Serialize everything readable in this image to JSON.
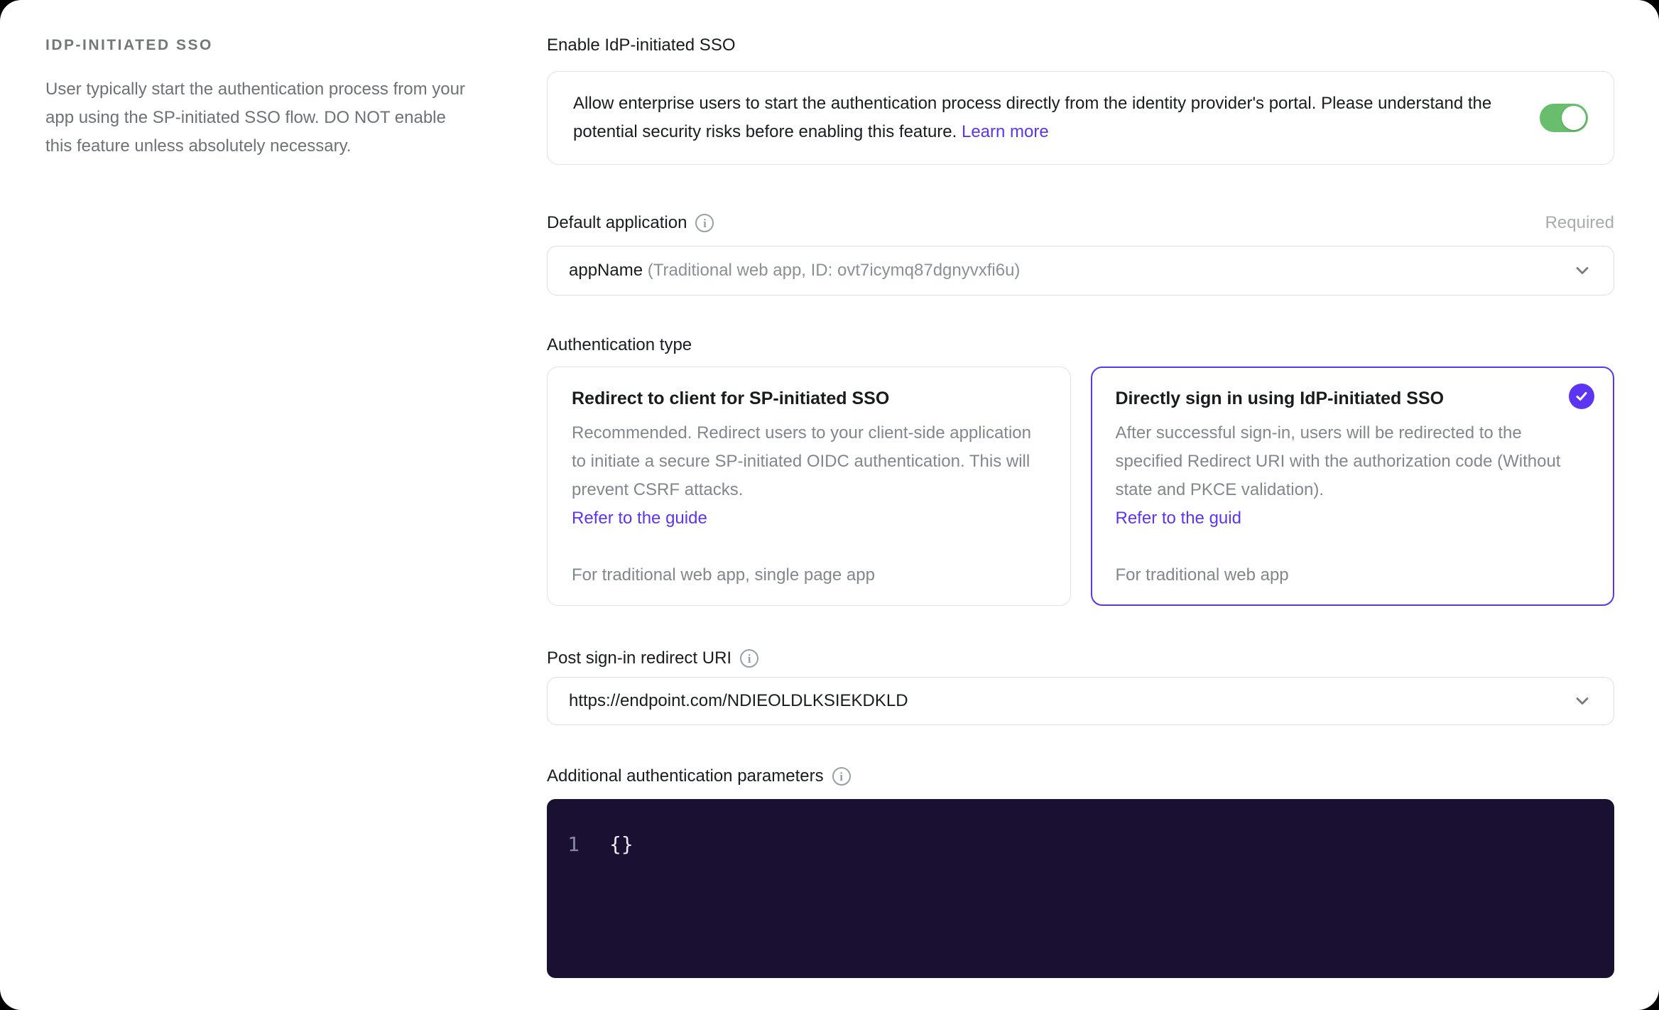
{
  "sidebar": {
    "section_title": "IDP-INITIATED SSO",
    "section_description": "User typically start the authentication process from your app using the SP-initiated SSO flow. DO NOT enable this feature unless absolutely necessary."
  },
  "enable_sso": {
    "label": "Enable IdP-initiated SSO",
    "description": "Allow enterprise users to start the authentication process directly from the identity provider's portal. Please understand the potential security risks before enabling this feature. ",
    "learn_more_label": "Learn more",
    "toggle_state": "on"
  },
  "default_application": {
    "label": "Default application",
    "required_label": "Required",
    "value_primary": "appName",
    "value_secondary": " (Traditional web app, ID: ovt7icymq87dgnyvxfi6u)"
  },
  "authentication_type": {
    "label": "Authentication type",
    "options": [
      {
        "title": "Redirect to client for SP-initiated SSO",
        "description": "Recommended. Redirect users to your client-side application to initiate a secure SP-initiated OIDC authentication. This will prevent CSRF attacks.",
        "link_label": "Refer to the guide",
        "footnote": "For traditional web app, single page app",
        "selected": false
      },
      {
        "title": "Directly sign in using IdP-initiated SSO",
        "description": "After successful sign-in, users will be redirected to the specified Redirect URI with the authorization code (Without state and PKCE validation).",
        "link_label": "Refer to the guid",
        "footnote": "For traditional web app",
        "selected": true
      }
    ]
  },
  "post_sign_in_redirect_uri": {
    "label": "Post sign-in redirect URI",
    "value": "https://endpoint.com/NDIEOLDLKSIEKDKLD"
  },
  "additional_auth_params": {
    "label": "Additional authentication parameters",
    "lines": [
      {
        "number": "1",
        "code": "{}"
      }
    ]
  },
  "colors": {
    "accent": "#5d34f2",
    "toggle_on": "#68be6c",
    "editor_bg": "#1a1031",
    "link": "#5d34f2"
  }
}
